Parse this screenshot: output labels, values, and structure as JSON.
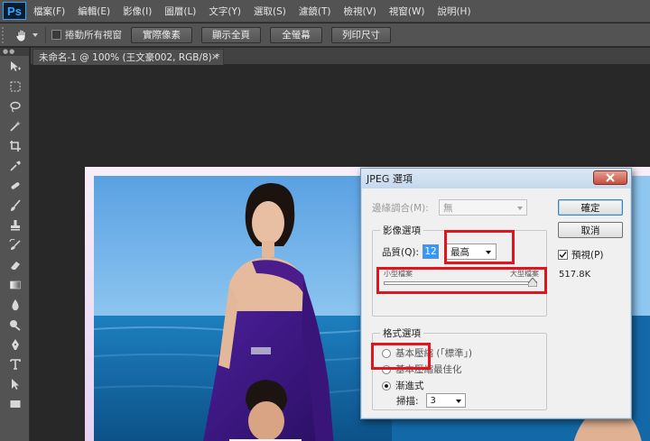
{
  "app": {
    "logo": "Ps",
    "menu": [
      "檔案(F)",
      "編輯(E)",
      "影像(I)",
      "圖層(L)",
      "文字(Y)",
      "選取(S)",
      "濾鏡(T)",
      "檢視(V)",
      "視窗(W)",
      "說明(H)"
    ]
  },
  "options_bar": {
    "scroll_all_label": "捲動所有視窗",
    "buttons": [
      "實際像素",
      "顯示全頁",
      "全螢幕",
      "列印尺寸"
    ]
  },
  "document_tab": {
    "title": "未命名-1 @ 100% (王文豪002, RGB/8) *",
    "close": "×"
  },
  "dialog": {
    "title": "JPEG 選項",
    "matte_label": "邊緣調合(M):",
    "matte_value": "無",
    "image_options": {
      "title": "影像選項",
      "quality_label": "品質(Q):",
      "quality_value": "12",
      "quality_level": "最高",
      "slider_left": "小型檔案",
      "slider_right": "大型檔案",
      "slider_fraction": 1.0
    },
    "format_options": {
      "title": "格式選項",
      "baseline_standard": "基本壓縮 (「標準」)",
      "baseline_optimized": "基本壓縮最佳化",
      "progressive": "漸進式",
      "scans_label": "掃描:",
      "scans_value": "3"
    },
    "ok_label": "確定",
    "cancel_label": "取消",
    "preview_label": "預視(P)",
    "preview_checked": true,
    "file_size": "517.8K"
  },
  "colors": {
    "highlight": "#e0151d",
    "ps_blue": "#31a8ff"
  }
}
